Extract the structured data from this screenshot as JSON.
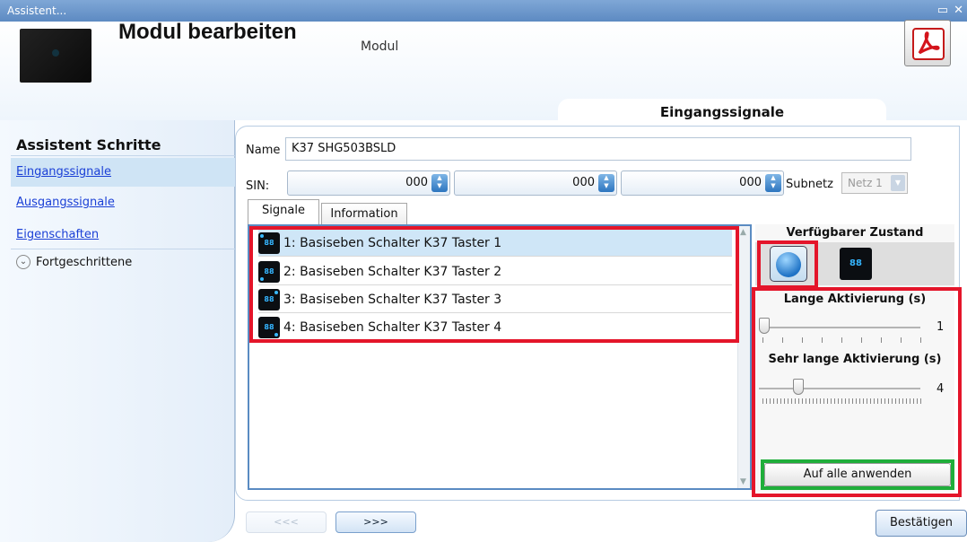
{
  "window": {
    "title": "Assistent...",
    "controls": [
      "▭",
      "✕"
    ]
  },
  "header": {
    "title": "Modul bearbeiten",
    "subtitle": "Modul",
    "section_tab": "Eingangssignale",
    "pdf_icon": "pdf-icon"
  },
  "sidebar": {
    "heading": "Assistent Schritte",
    "items": [
      {
        "label": "Eingangssignale",
        "active": true
      },
      {
        "label": "Ausgangssignale",
        "active": false
      },
      {
        "label": "Eigenschaften",
        "active": false
      }
    ],
    "advanced": {
      "label": "Fortgeschrittene",
      "icon": "chevron-down-icon"
    }
  },
  "form": {
    "name_label": "Name",
    "name_value": "K37 SHG503BSLD",
    "sin_label": "SIN:",
    "sin_values": [
      "000",
      "000",
      "000"
    ],
    "subnet_label": "Subnetz",
    "subnet_value": "Netz 1"
  },
  "tabs": [
    {
      "label": "Signale",
      "active": true
    },
    {
      "label": "Information",
      "active": false
    }
  ],
  "signals": [
    {
      "label": "1: Basiseben Schalter K37 Taster 1",
      "selected": true
    },
    {
      "label": "2: Basiseben Schalter K37 Taster 2",
      "selected": false
    },
    {
      "label": "3: Basiseben Schalter K37 Taster 3",
      "selected": false
    },
    {
      "label": "4: Basiseben Schalter K37 Taster 4",
      "selected": false
    }
  ],
  "signal_icon_text": "88",
  "state_panel": {
    "heading": "Verfügbarer Zustand",
    "long_label": "Lange Aktivierung (s)",
    "long_value": "1",
    "very_long_label": "Sehr lange Aktivierung (s)",
    "very_long_value": "4",
    "apply_label": "Auf alle anwenden"
  },
  "nav": {
    "back_label": "<<<",
    "next_label": ">>>",
    "confirm_label": "Bestätigen"
  },
  "colors": {
    "highlight_red": "#e4152a",
    "highlight_green": "#1fae3a",
    "selection": "#cfe6f7",
    "link": "#1a3fd6"
  }
}
